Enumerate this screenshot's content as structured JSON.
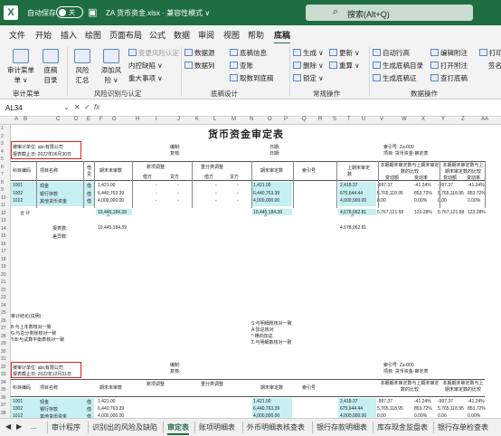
{
  "window": {
    "autosave_label": "自动保存",
    "toggle_state": "关",
    "file_name": "ZA 货币资金.xlsx · 兼容性模式 ∨",
    "search_placeholder": "搜索(Alt+Q)"
  },
  "menu": [
    "文件",
    "开始",
    "插入",
    "绘图",
    "页面布局",
    "公式",
    "数据",
    "审阅",
    "视图",
    "帮助",
    "底稿"
  ],
  "active_menu": "底稿",
  "ribbon": {
    "big_buttons": [
      {
        "label": "审计菜单",
        "sub": "单 ∨"
      },
      {
        "label": "底稿",
        "sub": "目录"
      },
      {
        "label": "风险",
        "sub": "汇总"
      },
      {
        "label": "添加风",
        "sub": "险 ∨"
      }
    ],
    "risk_small": [
      "变更风险认定",
      "内控缺陷 ∨",
      "重大事项 ∨"
    ],
    "design_items": [
      "数据源",
      "数据列",
      "底稿信息",
      "查账",
      "取数到底稿"
    ],
    "gen_items": [
      "生成 ∨",
      "删除 ∨",
      "锁定 ∨"
    ],
    "update_items": [
      "更新 ∨",
      "重算 ∨"
    ],
    "data_items": [
      "自动行高",
      "生成底稿目录",
      "生成底稿证"
    ],
    "edit_items": [
      "编辑附注",
      "打开附注",
      "查打底稿"
    ],
    "right_items": [
      "打印",
      "签名"
    ],
    "groups": [
      "审计菜单",
      "风险识别与认定",
      "底稿设计",
      "常规操作",
      "数据操作"
    ]
  },
  "formula": {
    "namebox": "AL34",
    "fx": "fx"
  },
  "columns": [
    "A",
    "B",
    "C",
    "D",
    "E",
    "F",
    "G",
    "H",
    "I",
    "J",
    "K",
    "L",
    "M",
    "N",
    "O",
    "P",
    "Q",
    "R",
    "S",
    "T",
    "U",
    "V",
    "W",
    "X",
    "Y",
    "Z",
    "AA"
  ],
  "rows": [
    "1",
    "2",
    "3",
    "4",
    "5",
    "6",
    "7",
    "8",
    "9",
    "10",
    "11",
    "12",
    "13",
    "14",
    "15",
    "16",
    "17",
    "18",
    "19",
    "20",
    "21",
    "22",
    "23",
    "24",
    "25",
    "26",
    "27",
    "28",
    "29",
    "30",
    "31",
    "32",
    "33",
    "34",
    "35",
    "36",
    "37",
    "38"
  ],
  "sheet": {
    "title": "货币资金审定表",
    "unit1": "被审计单位: abc有限公司",
    "date1": "报表截止日: 2022年06月30日",
    "unit2": "被审计单位: abc有限公司",
    "date2": "报表截止日: 2022年12月31日",
    "prepared": "编制:",
    "reviewed": "复核:",
    "date_label": "日期:",
    "index1": "索引号: Za-000",
    "project1": "项目: 货币资金-审定表",
    "index2": "索引号: Za-000",
    "project2": "项目: 货币资金-审定表",
    "headers": [
      "科目编码",
      "项目名称",
      "借贷",
      "期末未审数",
      "账项调整",
      "重分类调整",
      "期末审定数",
      "索引号",
      "上期末审定数",
      "本期期末审定数与上期末审定数的比较",
      "本期期末审定数与上期末审定数的比较"
    ],
    "subheaders": [
      "借方",
      "贷方",
      "借方",
      "贷方",
      "变动额",
      "变动率",
      "变动额",
      "变动率"
    ],
    "rows": [
      {
        "code": "1001",
        "name": "现金",
        "dc": "借",
        "unaudited": "1,421.00",
        "adj": "-",
        "adj2": "-",
        "rc": "-",
        "rc2": "-",
        "audited": "1,421.00",
        "prior": "2,418.37",
        "chg": "-997.37",
        "pct": "-41.24%",
        "chg2": "-997.37",
        "pct2": "-41.24%"
      },
      {
        "code": "1002",
        "name": "银行存款",
        "dc": "借",
        "unaudited": "6,440,763.39",
        "adj": "-",
        "adj2": "-",
        "rc": "-",
        "rc2": "-",
        "audited": "6,440,763.39",
        "prior": "675,644.44",
        "chg": "5,765,118.95",
        "pct": "853.72%",
        "chg2": "5,765,118.95",
        "pct2": "853.72%"
      },
      {
        "code": "1012",
        "name": "其他货币资金",
        "dc": "借",
        "unaudited": "4,000,000.00",
        "adj": "-",
        "adj2": "-",
        "rc": "-",
        "rc2": "-",
        "audited": "4,000,000.00",
        "prior": "4,000,000.00",
        "chg": "0.00",
        "pct": "0.00%",
        "chg2": "0.00",
        "pct2": "0.00%"
      }
    ],
    "total_label": "合  计",
    "total": {
      "unaudited": "10,445,184.39",
      "audited": "10,445,184.39",
      "prior": "4,678,062.81",
      "chg": "5,767,121.58",
      "pct": "123.28%",
      "chg2": "5,767,121.58",
      "pct2": "123.28%"
    },
    "report_label": "报表数:",
    "report_value": "10,445,184.39",
    "report_prior": "4,678,062.81",
    "diff_label": "差异数:",
    "conclusion": "审计结论(说明):",
    "notes_left": [
      "B:与上年数核对一致",
      "G:与总分类账核对一致",
      "T/B:与试算平衡表核对一致"
    ],
    "notes_right": [
      "S:与明细账核对一致",
      "A:加总核对",
      "^:横向加总",
      "Σ:与明细数核对一致"
    ],
    "rows2": [
      {
        "code": "1001",
        "name": "现金",
        "dc": "借",
        "unaudited": "1,421.00",
        "audited": "1,421.00",
        "prior": "2,418.37",
        "chg": "-997.37",
        "pct": "-41.24%",
        "chg2": "-997.37",
        "pct2": "-41.24%"
      },
      {
        "code": "1002",
        "name": "银行存款",
        "dc": "借",
        "unaudited": "6,440,763.39",
        "audited": "6,440,763.39",
        "prior": "675,644.44",
        "chg": "5,765,118.95",
        "pct": "853.72%",
        "chg2": "5,765,118.95",
        "pct2": "853.72%"
      },
      {
        "code": "1012",
        "name": "其他货币资金",
        "dc": "借",
        "unaudited": "4,000,000.00",
        "audited": "4,000,000.00",
        "prior": "4,000,000.00",
        "chg": "0.00",
        "pct": "0.00%",
        "chg2": "0.00",
        "pct2": "0.00%"
      }
    ]
  },
  "tabs": [
    "...",
    "审计程序",
    "识别出的风险及缺陷",
    "审定表",
    "账项明细表",
    "外币明细表核查表",
    "银行存款明细表",
    "库存现金监盘表",
    "银行存单检查表"
  ],
  "active_tab": "审定表",
  "colors": {
    "brand": "#1e6e42",
    "highlight": "#c6f0f3",
    "annotation": "#e02020"
  }
}
